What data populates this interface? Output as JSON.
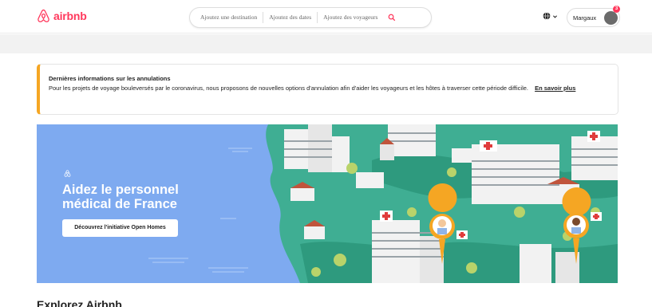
{
  "header": {
    "logo_text": "airbnb",
    "search": {
      "destination": "Ajoutez une destination",
      "dates": "Ajoutez des dates",
      "guests": "Ajoutez des voyageurs"
    },
    "user": {
      "name": "Margaux",
      "notification_count": "3"
    }
  },
  "info_banner": {
    "title": "Dernières informations sur les annulations",
    "body": "Pour les projets de voyage bouleversés par le coronavirus, nous proposons de nouvelles options d'annulation afin d'aider les voyageurs et les hôtes à traverser cette période difficile.",
    "link": "En savoir plus",
    "accent_color": "#f5a623"
  },
  "hero": {
    "title": "Aidez le personnel médical de France",
    "button_label": "Découvrez l'initiative Open Homes",
    "background_color": "#7eaaf0",
    "land_color": "#3fae93"
  },
  "explore_heading": "Explorez Airbnb",
  "colors": {
    "brand": "#ff385c"
  }
}
